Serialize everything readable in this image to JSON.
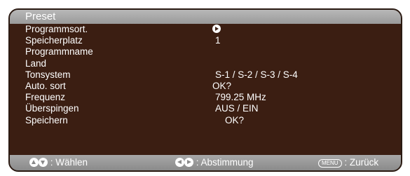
{
  "title": "Preset",
  "rows": [
    {
      "label": "Programmsort.",
      "value": "",
      "icon": "play-circle-icon"
    },
    {
      "label": "Speicherplatz",
      "value": "1"
    },
    {
      "label": "Programmname",
      "value": ""
    },
    {
      "label": "Land",
      "value": ""
    },
    {
      "label": "Tonsystem",
      "value": "S-1 / S-2 / S-3 / S-4"
    },
    {
      "label": "Auto. sort",
      "value": "OK?"
    },
    {
      "label": "Frequenz",
      "value": "799.25 MHz"
    },
    {
      "label": "Überspingen",
      "value": "AUS / EIN"
    },
    {
      "label": "Speichern",
      "value": "OK?"
    }
  ],
  "footer": {
    "select": ": Wählen",
    "tune": ": Abstimmung",
    "menu_key": "MENU",
    "back": ": Zurück"
  },
  "colors": {
    "panel": "#3b1e12",
    "bar": "#9a9a9a",
    "text": "#ffffff"
  }
}
